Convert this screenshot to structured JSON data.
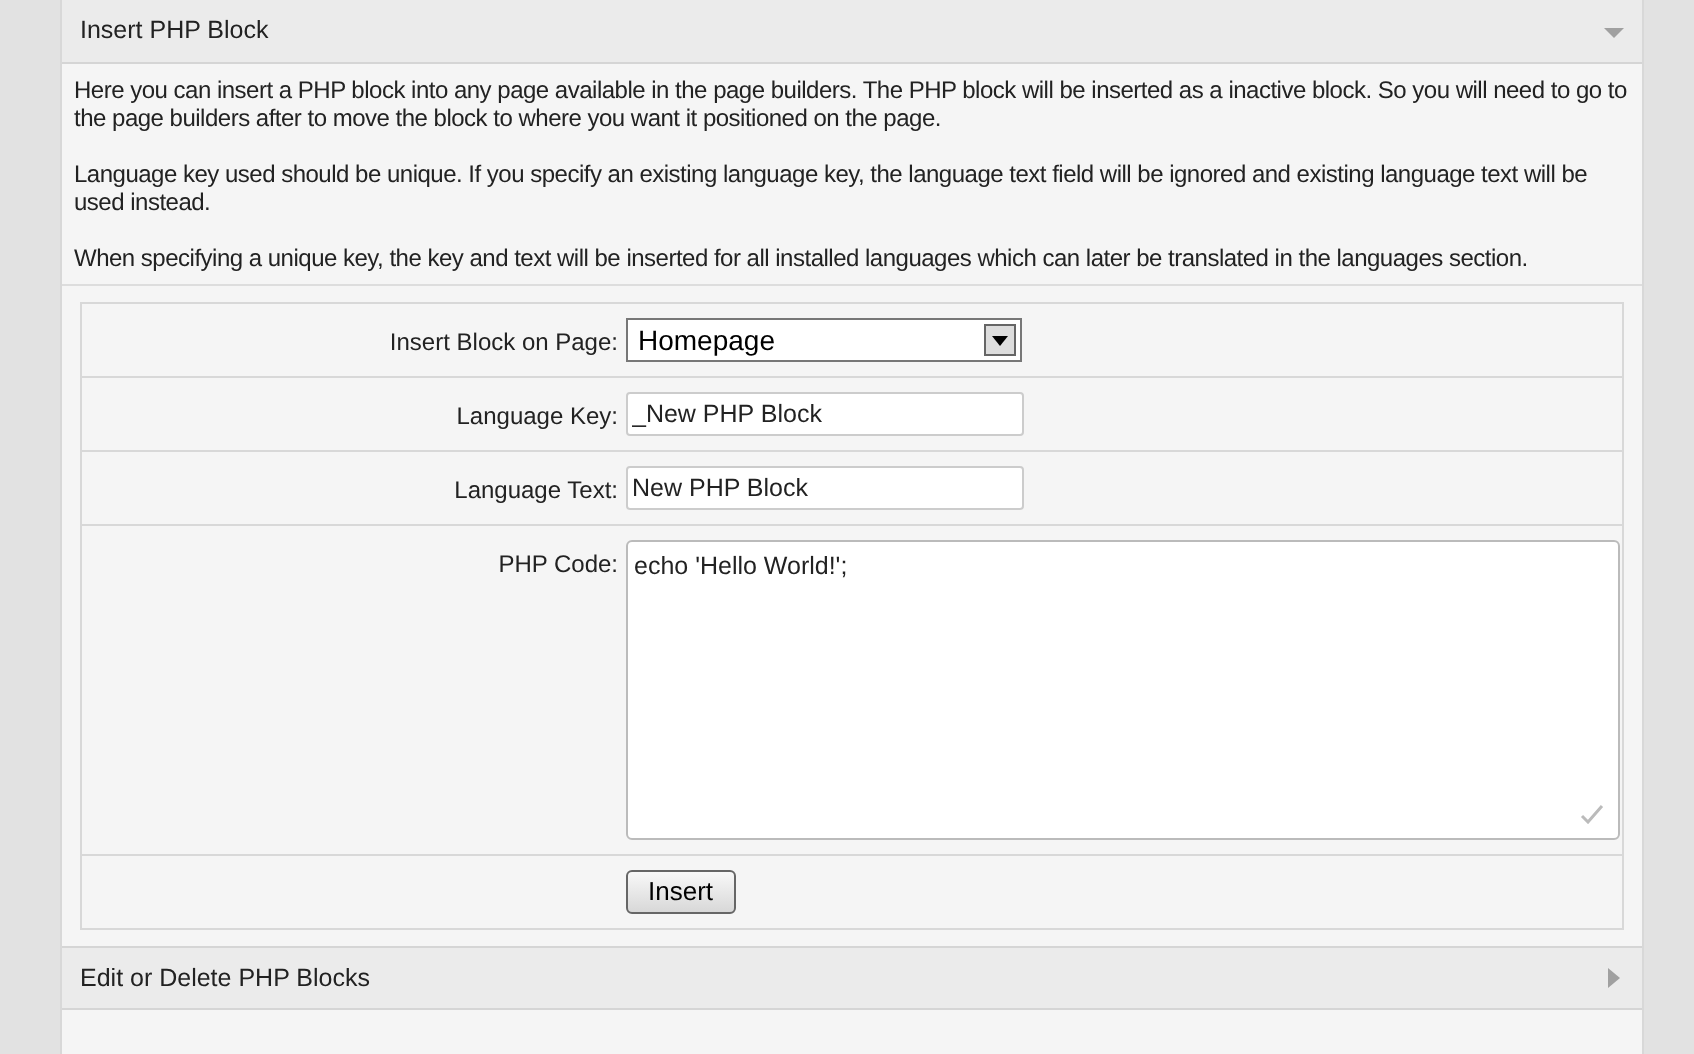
{
  "sections": [
    {
      "title": "Insert PHP Block",
      "expanded": true,
      "paragraphs": [
        "Here you can insert a PHP block into any page available in the page builders. The PHP block will be inserted as a inactive block. So you will need to go to the page builders after to move the block to where you want it positioned on the page.",
        "Language key used should be unique. If you specify an existing language key, the language text field will be ignored and existing language text will be used instead.",
        "When specifying a unique key, the key and text will be inserted for all installed languages which can later be translated in the languages section."
      ],
      "form": [
        {
          "kind": "select",
          "label": "Insert Block on Page:",
          "value": "Homepage"
        },
        {
          "kind": "input",
          "label": "Language Key:",
          "value": "_New PHP Block"
        },
        {
          "kind": "input",
          "label": "Language Text:",
          "value": "New PHP Block"
        },
        {
          "kind": "textarea",
          "label": "PHP Code:",
          "value": "echo 'Hello World!';"
        },
        {
          "kind": "button",
          "label": "Insert"
        }
      ]
    },
    {
      "title": "Edit or Delete PHP Blocks",
      "expanded": false
    }
  ]
}
